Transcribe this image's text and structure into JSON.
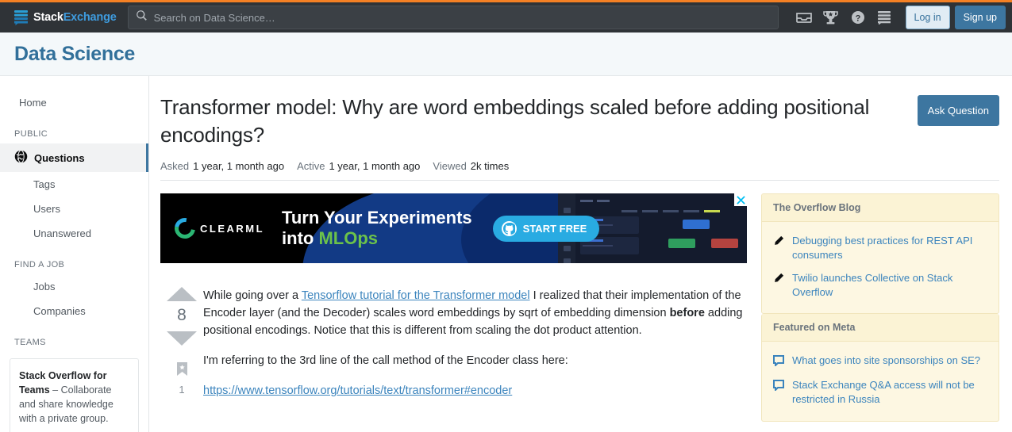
{
  "topbar": {
    "logo": {
      "word1": "Stack",
      "word2": "Exchange",
      "icon": "stack-logo-icon"
    },
    "search": {
      "placeholder": "Search on Data Science…",
      "value": "",
      "icon": "search-icon"
    },
    "icons": [
      {
        "name": "inbox-icon",
        "label": "Inbox"
      },
      {
        "name": "trophy-icon",
        "label": "Achievements"
      },
      {
        "name": "help-icon",
        "label": "Help"
      },
      {
        "name": "stack-exchange-icon",
        "label": "Stack Exchange"
      }
    ],
    "login_label": "Log in",
    "signup_label": "Sign up",
    "accent_orange": "#f48024",
    "background": "#2f3337"
  },
  "site": {
    "title": "Data Science",
    "title_color": "#32709a",
    "header_background": "#f4f8fa"
  },
  "sidebar": {
    "home_label": "Home",
    "sections": [
      {
        "title": "PUBLIC",
        "items": [
          {
            "label": "Questions",
            "icon": "globe-icon",
            "active": true
          },
          {
            "label": "Tags",
            "active": false
          },
          {
            "label": "Users",
            "active": false
          },
          {
            "label": "Unanswered",
            "active": false
          }
        ]
      },
      {
        "title": "FIND A JOB",
        "items": [
          {
            "label": "Jobs",
            "active": false
          },
          {
            "label": "Companies",
            "active": false
          }
        ]
      },
      {
        "title": "TEAMS",
        "items": []
      }
    ],
    "teams_card": {
      "brand": "Stack Overflow for Teams",
      "text": " – Collaborate and share knowledge with a private group."
    },
    "active_marker_color": "#3d76a0"
  },
  "question": {
    "title": "Transformer model: Why are word embeddings scaled before adding positional encodings?",
    "ask_button_label": "Ask Question",
    "meta": [
      {
        "label": "Asked",
        "value": "1 year, 1 month ago"
      },
      {
        "label": "Active",
        "value": "1 year, 1 month ago"
      },
      {
        "label": "Viewed",
        "value": "2k times"
      }
    ],
    "vote_count": "8",
    "bookmark_count": "1",
    "body": {
      "p1_before_link": "While going over a ",
      "p1_link": "Tensorflow tutorial for the Transformer model",
      "p1_after_link": " I realized that their implementation of the Encoder layer (and the Decoder) scales word embeddings by sqrt of embedding dimension ",
      "p1_bold": "before",
      "p1_tail": " adding positional encodings. Notice that this is different from scaling the dot product attention.",
      "p2": "I'm referring to the 3rd line of the call method of the Encoder class here:",
      "p2_link": "https://www.tensorflow.org/tutorials/text/transformer#encoder"
    }
  },
  "ad": {
    "brand": "CLEARML",
    "headline_line1": "Turn Your Experiments",
    "headline_line2_plain": "into ",
    "headline_line2_accent": "MLOps",
    "cta_label": "START FREE",
    "cta_icon": "github-icon",
    "close_icon": "close-icon",
    "accent_green": "#6cc24a",
    "cta_background": "#29abe2"
  },
  "rightbar": {
    "widgets": [
      {
        "title": "The Overflow Blog",
        "icon": "pencil-icon",
        "items": [
          "Debugging best practices for REST API consumers",
          "Twilio launches Collective on Stack Overflow"
        ]
      },
      {
        "title": "Featured on Meta",
        "icon": "speech-bubble-icon",
        "items": [
          "What goes into site sponsorships on SE?",
          "Stack Exchange Q&A access will not be restricted in Russia"
        ]
      }
    ]
  }
}
